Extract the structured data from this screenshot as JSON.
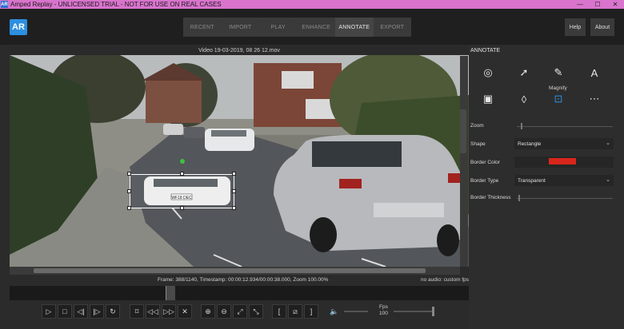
{
  "titlebar": {
    "logo": "AR",
    "title": "Amped Replay - UNLICENSED TRIAL - NOT FOR USE ON REAL CASES",
    "minimize": "—",
    "maximize": "☐",
    "close": "✕"
  },
  "header": {
    "logo": "AR",
    "tabs": [
      {
        "label": "RECENT"
      },
      {
        "label": "IMPORT"
      },
      {
        "label": "PLAY"
      },
      {
        "label": "ENHANCE"
      },
      {
        "label": "ANNOTATE"
      },
      {
        "label": "EXPORT"
      }
    ],
    "active_tab": "ANNOTATE",
    "help_label": "Help",
    "about_label": "About"
  },
  "video": {
    "title": "Video 19-03-2019, 08 26 12.mov",
    "plate_text": "WF18 DEC"
  },
  "status": {
    "text": "Frame: 388/1140, Timestamp: 00:00:12.934/00:00:38.000,  Zoom 100.00%",
    "audio": "no audio: custom fps"
  },
  "controls": {
    "fps_label": "Fps",
    "fps_value": "100"
  },
  "annotate_panel": {
    "header": "ANNOTATE",
    "selected_tool_caption": "Magnify",
    "zoom_label": "Zoom",
    "shape_label": "Shape",
    "shape_value": "Rectangle",
    "border_color_label": "Border Color",
    "border_color": "#d9261c",
    "border_type_label": "Border Type",
    "border_type_value": "Transparent",
    "border_thickness_label": "Border Thickness"
  },
  "colors": {
    "accent": "#2d8fe0",
    "titlebar": "#d874cc",
    "selection_handle": "#3fbf3f"
  }
}
